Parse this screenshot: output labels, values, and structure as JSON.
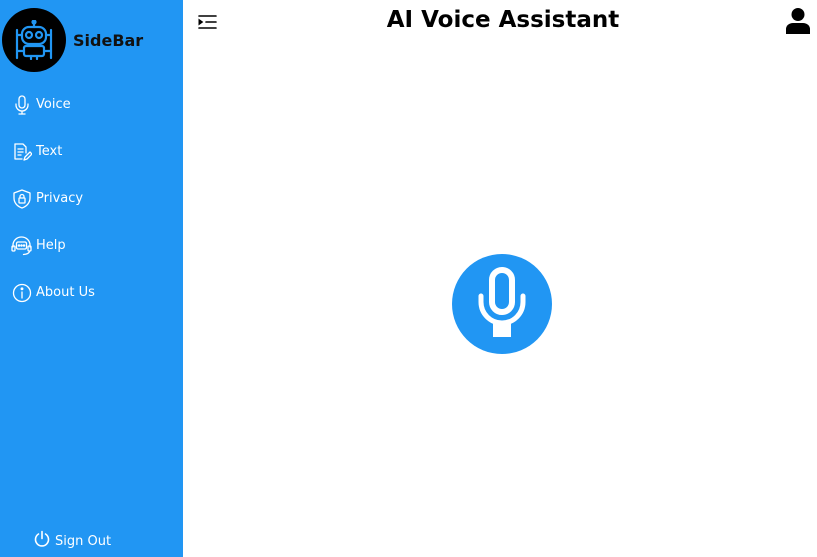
{
  "sidebar": {
    "brand": {
      "title": "SideBar",
      "logo_icon": "robot-icon"
    },
    "items": [
      {
        "label": "Voice",
        "icon": "microphone-icon"
      },
      {
        "label": "Text",
        "icon": "document-edit-icon"
      },
      {
        "label": "Privacy",
        "icon": "shield-lock-icon"
      },
      {
        "label": "Help",
        "icon": "headset-chat-icon"
      },
      {
        "label": "About Us",
        "icon": "info-icon"
      }
    ],
    "signout": {
      "label": "Sign Out",
      "icon": "power-icon"
    }
  },
  "header": {
    "title": "AI Voice Assistant",
    "menu_icon": "menu-toggle-icon",
    "user_icon": "user-icon"
  },
  "main": {
    "mic_icon": "microphone-icon"
  },
  "colors": {
    "accent": "#2196f3",
    "text_dark": "#000000",
    "text_light": "#ffffff",
    "logo_bg": "#000000",
    "logo_line": "#2196f3"
  }
}
